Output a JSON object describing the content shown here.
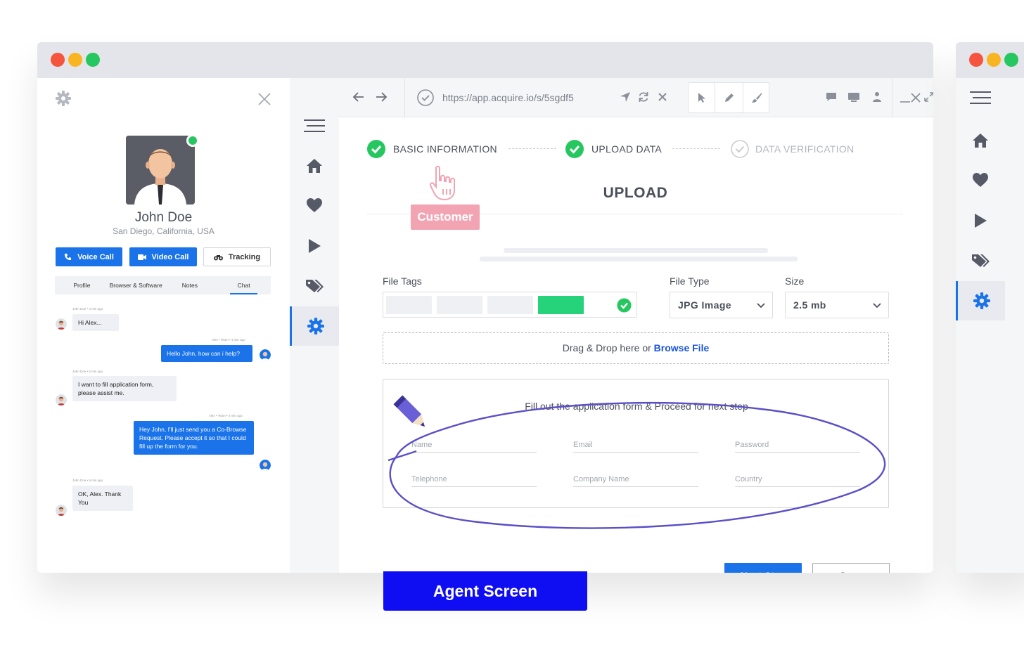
{
  "agent_panel": {
    "name": "John Doe",
    "location": "San Diego, California, USA",
    "actions": {
      "voice": "Voice Call",
      "video": "Video Call",
      "tracking": "Tracking"
    },
    "tabs": [
      "Profile",
      "Browser & Software",
      "Notes",
      "Chat"
    ],
    "active_tab": "Chat",
    "messages": [
      {
        "from": "customer",
        "meta": "John Doe • 4 min ago",
        "text": "Hi Alex..."
      },
      {
        "from": "agent",
        "meta": "Alex • Team • 4 min ago",
        "text": "Hello John, how can i help?"
      },
      {
        "from": "customer",
        "meta": "John Doe • 5 min ago",
        "text": "I want to fill application form, please assist me."
      },
      {
        "from": "agent",
        "meta": "Alex • Team • 4 min ago",
        "text": "Hey John, I'll just send you a Co-Browse Request. Please accept it so that I could fill up the form for you."
      },
      {
        "from": "customer",
        "meta": "John Doe • 5 min ago",
        "text": "OK, Alex. Thank You"
      }
    ]
  },
  "browser": {
    "url": "https://app.acquire.io/s/5sgdf5"
  },
  "steps": [
    {
      "label": "BASIC INFORMATION",
      "done": true
    },
    {
      "label": "UPLOAD DATA",
      "done": true
    },
    {
      "label": "DATA VERIFICATION",
      "done": false
    }
  ],
  "upload": {
    "title": "UPLOAD",
    "customer_tag": "Customer",
    "file_tags_label": "File Tags",
    "file_type_label": "File Type",
    "file_type_value": "JPG Image",
    "size_label": "Size",
    "size_value": "2.5 mb",
    "drop_text": "Drag & Drop here or ",
    "drop_link": "Browse File",
    "form_hint": "Fill out the application form & Proceed for next step",
    "fields": [
      "Name",
      "Email",
      "Password",
      "Telephone",
      "Company Name",
      "Country"
    ],
    "next_label": "Next Step",
    "save_label": "Save"
  },
  "caption": "Agent Screen",
  "colors": {
    "primary": "#1a73e8",
    "success": "#26c760",
    "caption_bg": "#0f0df2",
    "annotation": "#5a4fc7",
    "customer_tag": "#f2a4b3"
  }
}
